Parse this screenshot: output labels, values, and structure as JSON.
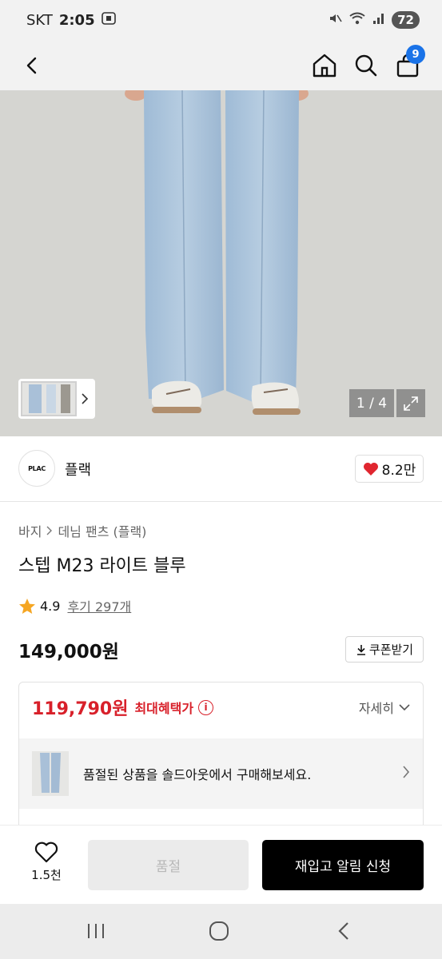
{
  "status_bar": {
    "carrier": "SKT",
    "time": "2:05",
    "battery": "72"
  },
  "header": {
    "cart_count": "9",
    "icons": [
      "back-icon",
      "home-icon",
      "search-icon",
      "shopping-bag-icon"
    ]
  },
  "gallery": {
    "counter": "1 / 4"
  },
  "brand": {
    "logo_text": "PLAC",
    "name": "플랙",
    "likes": "8.2만"
  },
  "product": {
    "breadcrumb": [
      "바지",
      "데님 팬츠 (플랙)"
    ],
    "title": "스텝 M23 라이트 블루",
    "rating": "4.9",
    "reviews": "후기 297개",
    "price": "149,000원",
    "coupon_label": "쿠폰받기"
  },
  "benefit": {
    "max_price": "119,790원",
    "max_label": "최대혜택가",
    "detail_label": "자세히",
    "soldout_message": "품절된 상품을 솔드아웃에서 구매해보세요."
  },
  "bottom_bar": {
    "wish_count": "1.5천",
    "soldout_label": "품절",
    "restock_label": "재입고 알림 신청"
  },
  "colors": {
    "accent_red": "#d8202a",
    "cart_badge": "#1a73e8",
    "primary_button": "#000000"
  }
}
